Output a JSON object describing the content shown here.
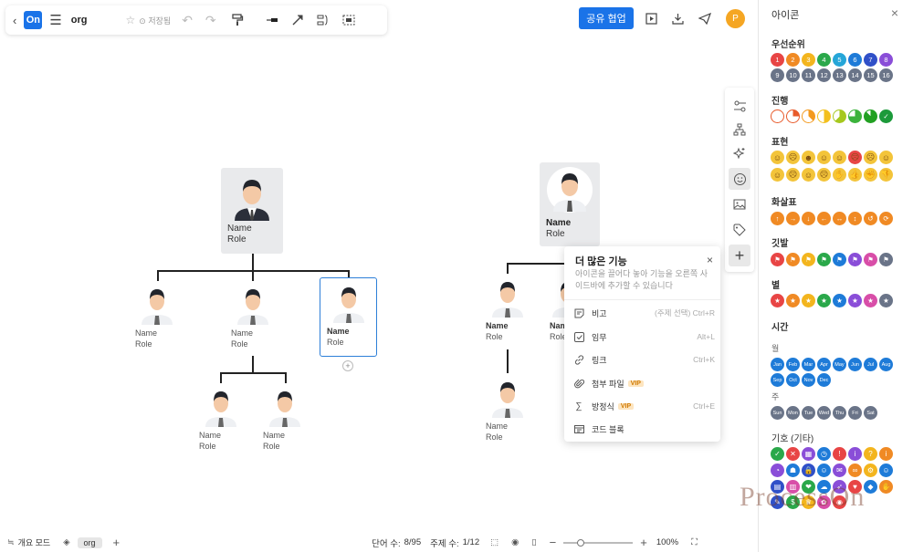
{
  "topbar": {
    "file_name": "org",
    "saved_label": "저장됨",
    "logo_label": "On"
  },
  "header_right": {
    "share_label": "공유 협업",
    "user_initial": "P"
  },
  "nodes": [
    {
      "name": "Name",
      "role": "Role"
    },
    {
      "name": "Name",
      "role": "Role"
    },
    {
      "name": "Name",
      "role": "Role"
    },
    {
      "name": "Name",
      "role": "Role"
    },
    {
      "name": "Name",
      "role": "Role"
    },
    {
      "name": "Name",
      "role": "Role"
    },
    {
      "name": "Name",
      "role": "Role"
    },
    {
      "name": "Name",
      "role": "Role"
    },
    {
      "name": "Name",
      "role": "Role"
    },
    {
      "name": "Name",
      "role": "Role"
    },
    {
      "name": "Nam",
      "role": "Role"
    }
  ],
  "popup": {
    "title": "더 많은 기능",
    "desc": "아이콘을 끌어다 놓아 기능을 오른쪽 사이드바에 추가할 수 있습니다",
    "items": [
      {
        "label": "비고",
        "shortcut": "(주제 선택) Ctrl+R",
        "icon": "note-icon"
      },
      {
        "label": "임무",
        "shortcut": "Alt+L",
        "icon": "task-icon"
      },
      {
        "label": "링크",
        "shortcut": "Ctrl+K",
        "icon": "link-icon"
      },
      {
        "label": "첨부 파일",
        "shortcut": "",
        "icon": "attachment-icon",
        "badge": "VIP"
      },
      {
        "label": "방정식",
        "shortcut": "Ctrl+E",
        "icon": "formula-icon",
        "badge": "VIP"
      },
      {
        "label": "코드 블록",
        "shortcut": "",
        "icon": "code-block-icon"
      }
    ]
  },
  "bottombar": {
    "outline_label": "개요 모드",
    "sheet_tab": "org",
    "word_count_label": "단어 수:",
    "word_count": "8/95",
    "topic_count_label": "주제 수:",
    "topic_count": "1/12",
    "zoom": "100%"
  },
  "panel": {
    "title": "아이콘",
    "sections": {
      "priority": "우선순위",
      "progress": "진행",
      "expression": "표현",
      "arrow": "화살표",
      "flag": "깃발",
      "star": "별",
      "time": "시간",
      "month": "월",
      "week": "주",
      "symbol": "기호 (기타)"
    },
    "priority_numbers": [
      "1",
      "2",
      "3",
      "4",
      "5",
      "6",
      "7",
      "8",
      "9",
      "10",
      "11",
      "12",
      "13",
      "14",
      "15",
      "16"
    ],
    "months": [
      "Jan",
      "Feb",
      "Mar",
      "Apr",
      "May",
      "Jun",
      "Jul",
      "Aug",
      "Sep",
      "Oct",
      "Nov",
      "Dec"
    ],
    "weekdays": [
      "Sun",
      "Mon",
      "Tue",
      "Wed",
      "Thu",
      "Fri",
      "Sat"
    ]
  },
  "watermark": "ProcessOn",
  "colors": {
    "accent": "#1a73e8",
    "selection": "#2d7fd8"
  }
}
